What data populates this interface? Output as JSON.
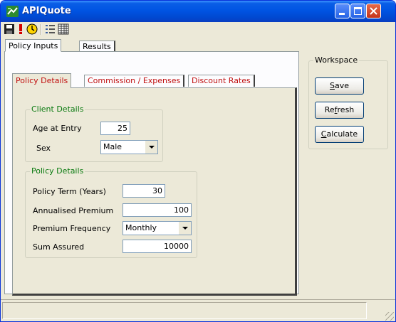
{
  "window": {
    "title": "APIQuote"
  },
  "title_buttons": {
    "minimize": "minimize",
    "maximize": "maximize",
    "close": "close"
  },
  "toolbar": {
    "icons": [
      "save-icon",
      "exclamation-icon",
      "clock-icon",
      "details-view-icon",
      "grid-view-icon"
    ]
  },
  "outer_tabs": {
    "policy_inputs": "Policy Inputs",
    "results": "Results"
  },
  "inner_tabs": {
    "policy_details": "Policy Details",
    "commission_expenses": "Commission / Expenses",
    "discount_rates": "Discount Rates"
  },
  "client_details": {
    "title": "Client Details",
    "age_label": "Age at Entry",
    "age_value": "25",
    "sex_label": "Sex",
    "sex_value": "Male"
  },
  "policy_details": {
    "title": "Policy Details",
    "term_label": "Policy Term (Years)",
    "term_value": "30",
    "premium_label": "Annualised Premium",
    "premium_value": "100",
    "frequency_label": "Premium Frequency",
    "frequency_value": "Monthly",
    "sum_label": "Sum Assured",
    "sum_value": "10000"
  },
  "workspace": {
    "title": "Workspace",
    "save_first": "S",
    "save_rest": "ave",
    "refresh_pre": "Re",
    "refresh_u": "f",
    "refresh_post": "resh",
    "calculate_first": "C",
    "calculate_rest": "alculate"
  },
  "colors": {
    "title_bar": "#0054e3",
    "group_title": "#0a7a10",
    "tab_text_red": "#c01010",
    "window_bg": "#ece9d8"
  }
}
